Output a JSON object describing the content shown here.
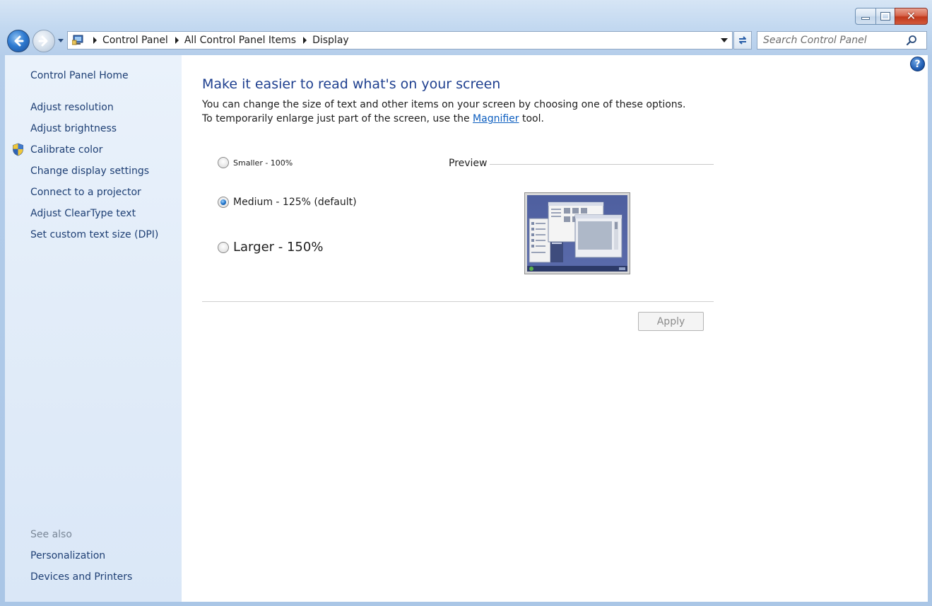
{
  "window": {
    "min_label": "minimize",
    "max_label": "maximize",
    "close_label": "close"
  },
  "address_bar": {
    "crumbs": [
      "Control Panel",
      "All Control Panel Items",
      "Display"
    ]
  },
  "search": {
    "placeholder": "Search Control Panel"
  },
  "sidebar": {
    "home": "Control Panel Home",
    "items": [
      "Adjust resolution",
      "Adjust brightness",
      "Calibrate color",
      "Change display settings",
      "Connect to a projector",
      "Adjust ClearType text",
      "Set custom text size (DPI)"
    ],
    "see_also_title": "See also",
    "see_also": [
      "Personalization",
      "Devices and Printers"
    ]
  },
  "main": {
    "heading": "Make it easier to read what's on your screen",
    "desc_before": "You can change the size of text and other items on your screen by choosing one of these options. To temporarily enlarge just part of the screen, use the ",
    "desc_link": "Magnifier",
    "desc_after": " tool.",
    "options": [
      {
        "label": "Smaller - 100%",
        "checked": false
      },
      {
        "label": "Medium - 125% (default)",
        "checked": true
      },
      {
        "label": "Larger - 150%",
        "checked": false
      }
    ],
    "preview_label": "Preview",
    "apply_label": "Apply",
    "help_label": "?"
  },
  "colors": {
    "link": "#1e3f74",
    "heading": "#1e3f8f",
    "hyperlink": "#0b5dbf"
  }
}
